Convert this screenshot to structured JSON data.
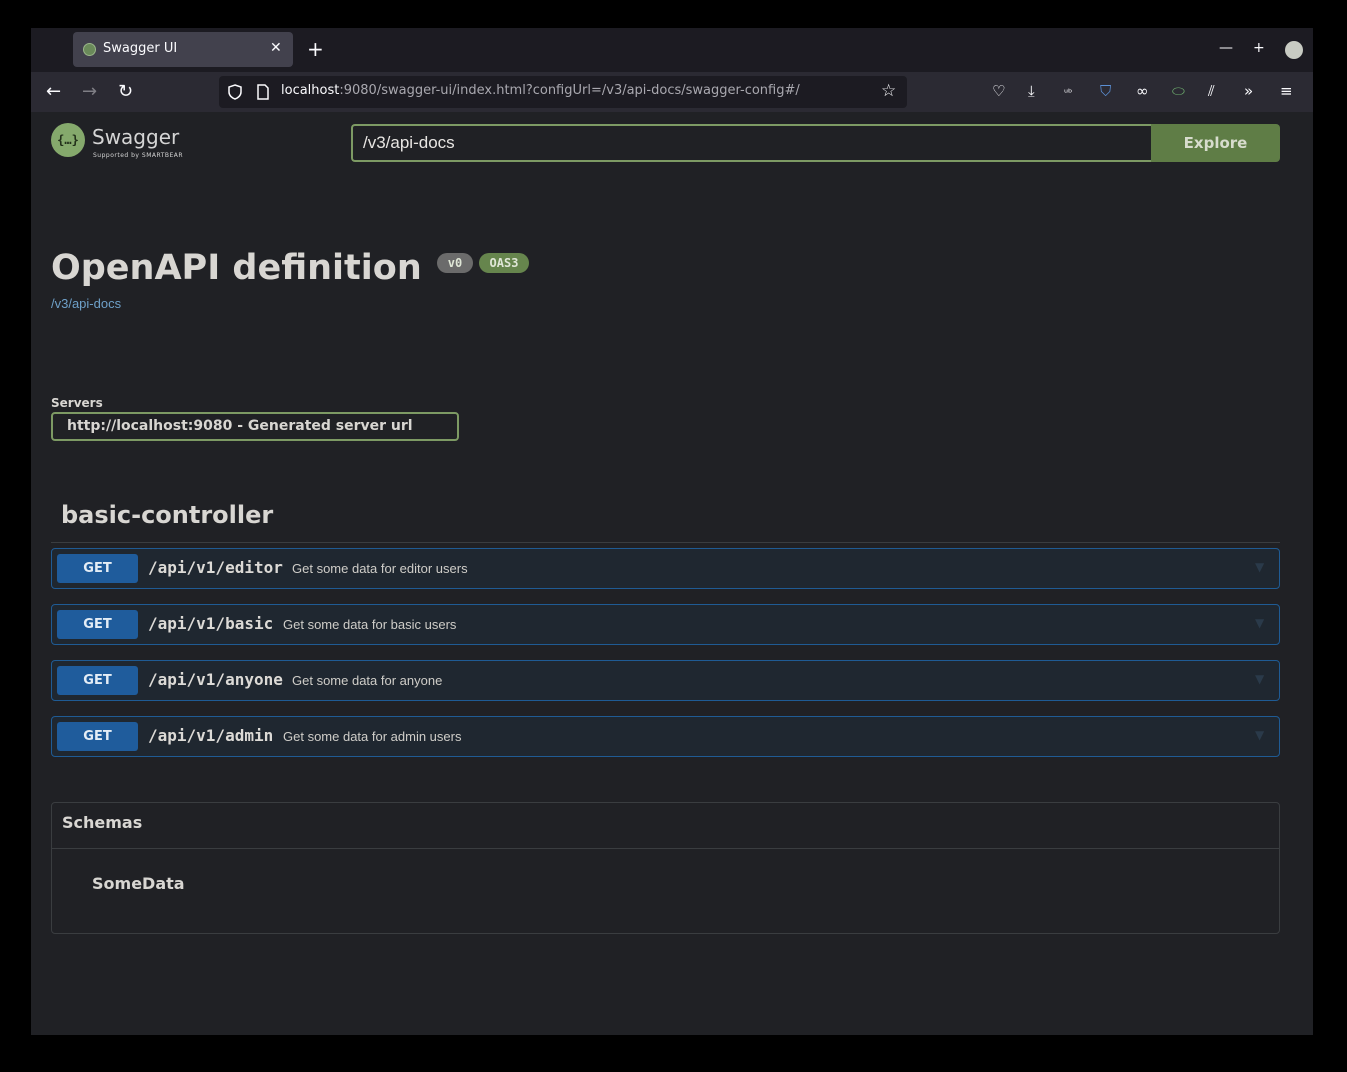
{
  "browser": {
    "tab_title": "Swagger UI",
    "url_host": "localhost",
    "url_rest": ":9080/swagger-ui/index.html?configUrl=/v3/api-docs/swagger-config#/"
  },
  "topbar": {
    "logo_text": "Swagger",
    "logo_sub": "Supported by SMARTBEAR",
    "search_value": "/v3/api-docs",
    "explore_label": "Explore"
  },
  "info": {
    "title": "OpenAPI definition",
    "version_badge": "v0",
    "oas_badge": "OAS3",
    "spec_link": "/v3/api-docs"
  },
  "servers": {
    "label": "Servers",
    "selected": "http://localhost:9080 - Generated server url"
  },
  "tag": {
    "name": "basic-controller"
  },
  "operations": [
    {
      "method": "GET",
      "path": "/api/v1/editor",
      "summary": "Get some data for editor users"
    },
    {
      "method": "GET",
      "path": "/api/v1/basic",
      "summary": "Get some data for basic users"
    },
    {
      "method": "GET",
      "path": "/api/v1/anyone",
      "summary": "Get some data for anyone"
    },
    {
      "method": "GET",
      "path": "/api/v1/admin",
      "summary": "Get some data for admin users"
    }
  ],
  "schemas": {
    "title": "Schemas",
    "items": [
      "SomeData"
    ]
  },
  "colors": {
    "get_method": "#1f5c9c",
    "accent_green": "#7d9a64",
    "page_bg": "#202125"
  }
}
